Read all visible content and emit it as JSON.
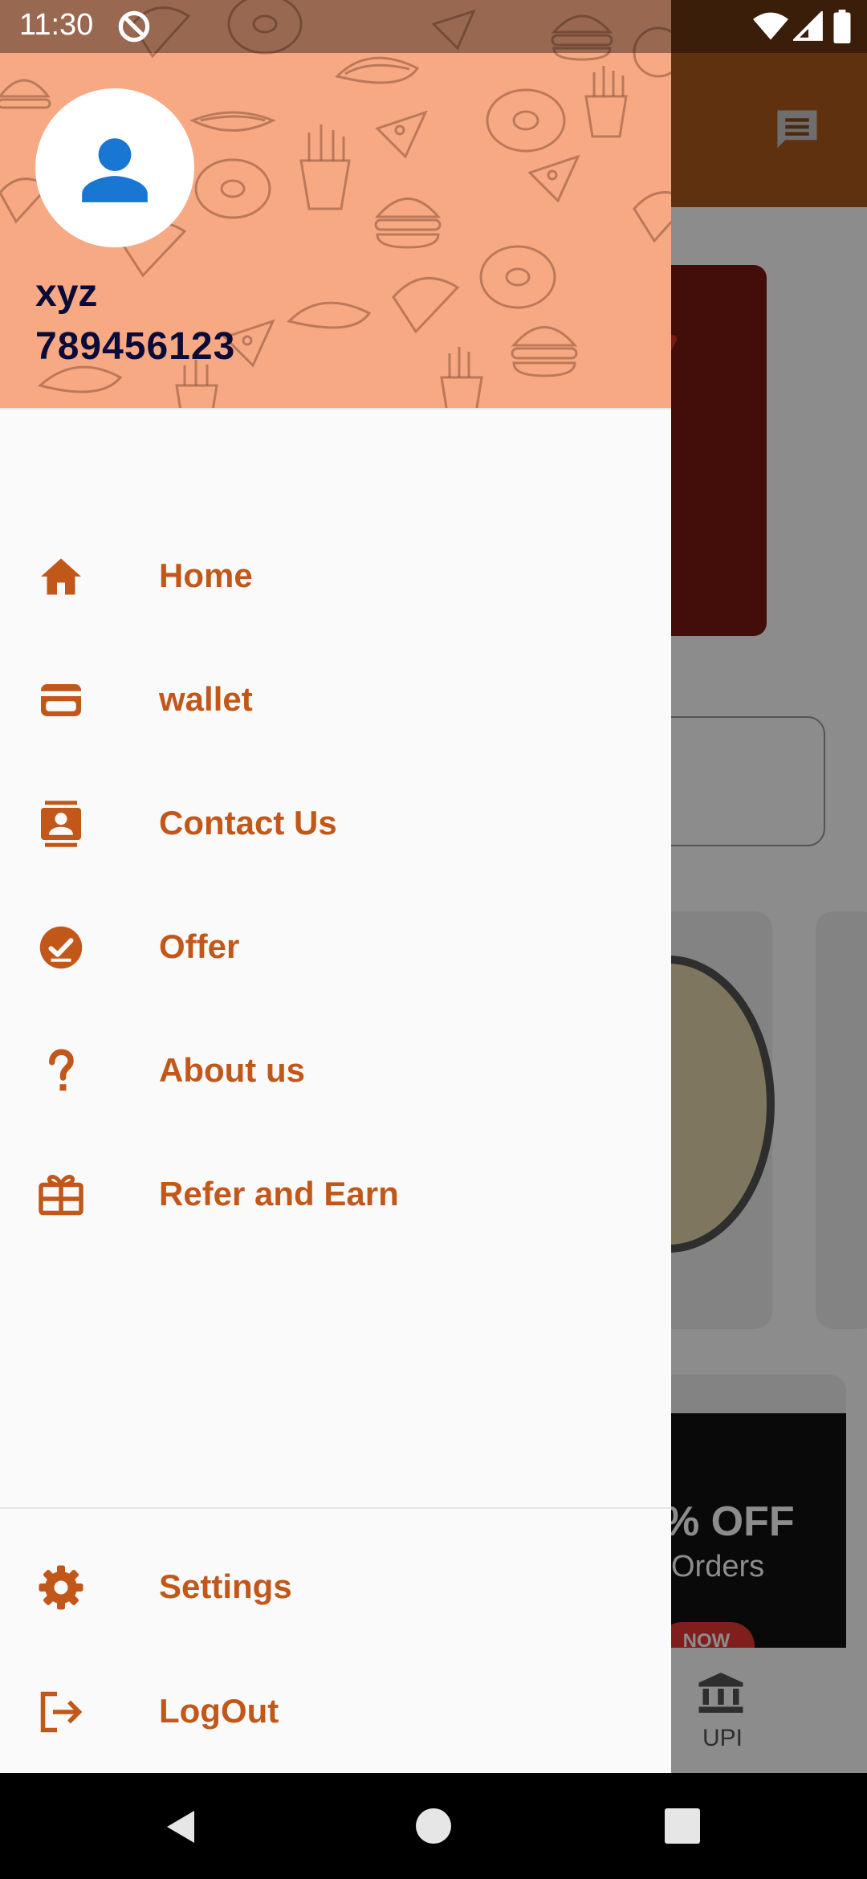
{
  "status_bar": {
    "time": "11:30"
  },
  "drawer": {
    "user": {
      "name": "xyz",
      "phone": "789456123"
    },
    "items": [
      {
        "label": "Home",
        "icon": "home-icon"
      },
      {
        "label": "wallet",
        "icon": "wallet-icon"
      },
      {
        "label": "Contact Us",
        "icon": "contact-icon"
      },
      {
        "label": "Offer",
        "icon": "offer-icon"
      },
      {
        "label": "About us",
        "icon": "help-icon"
      },
      {
        "label": "Refer and Earn",
        "icon": "gift-icon"
      }
    ],
    "footer_items": [
      {
        "label": "Settings",
        "icon": "gear-icon"
      },
      {
        "label": "LogOut",
        "icon": "logout-icon"
      }
    ]
  },
  "background": {
    "banner_text": "% OFF",
    "banner_subtext": "Orders",
    "banner_button": "NOW",
    "bottom_nav": {
      "upi_label": "UPI"
    }
  },
  "colors": {
    "accent": "#c2571a",
    "toolbar": "#b05a1c",
    "header_bg": "#f7a983",
    "avatar_icon": "#1976d2",
    "user_text": "#0b0b3a"
  }
}
